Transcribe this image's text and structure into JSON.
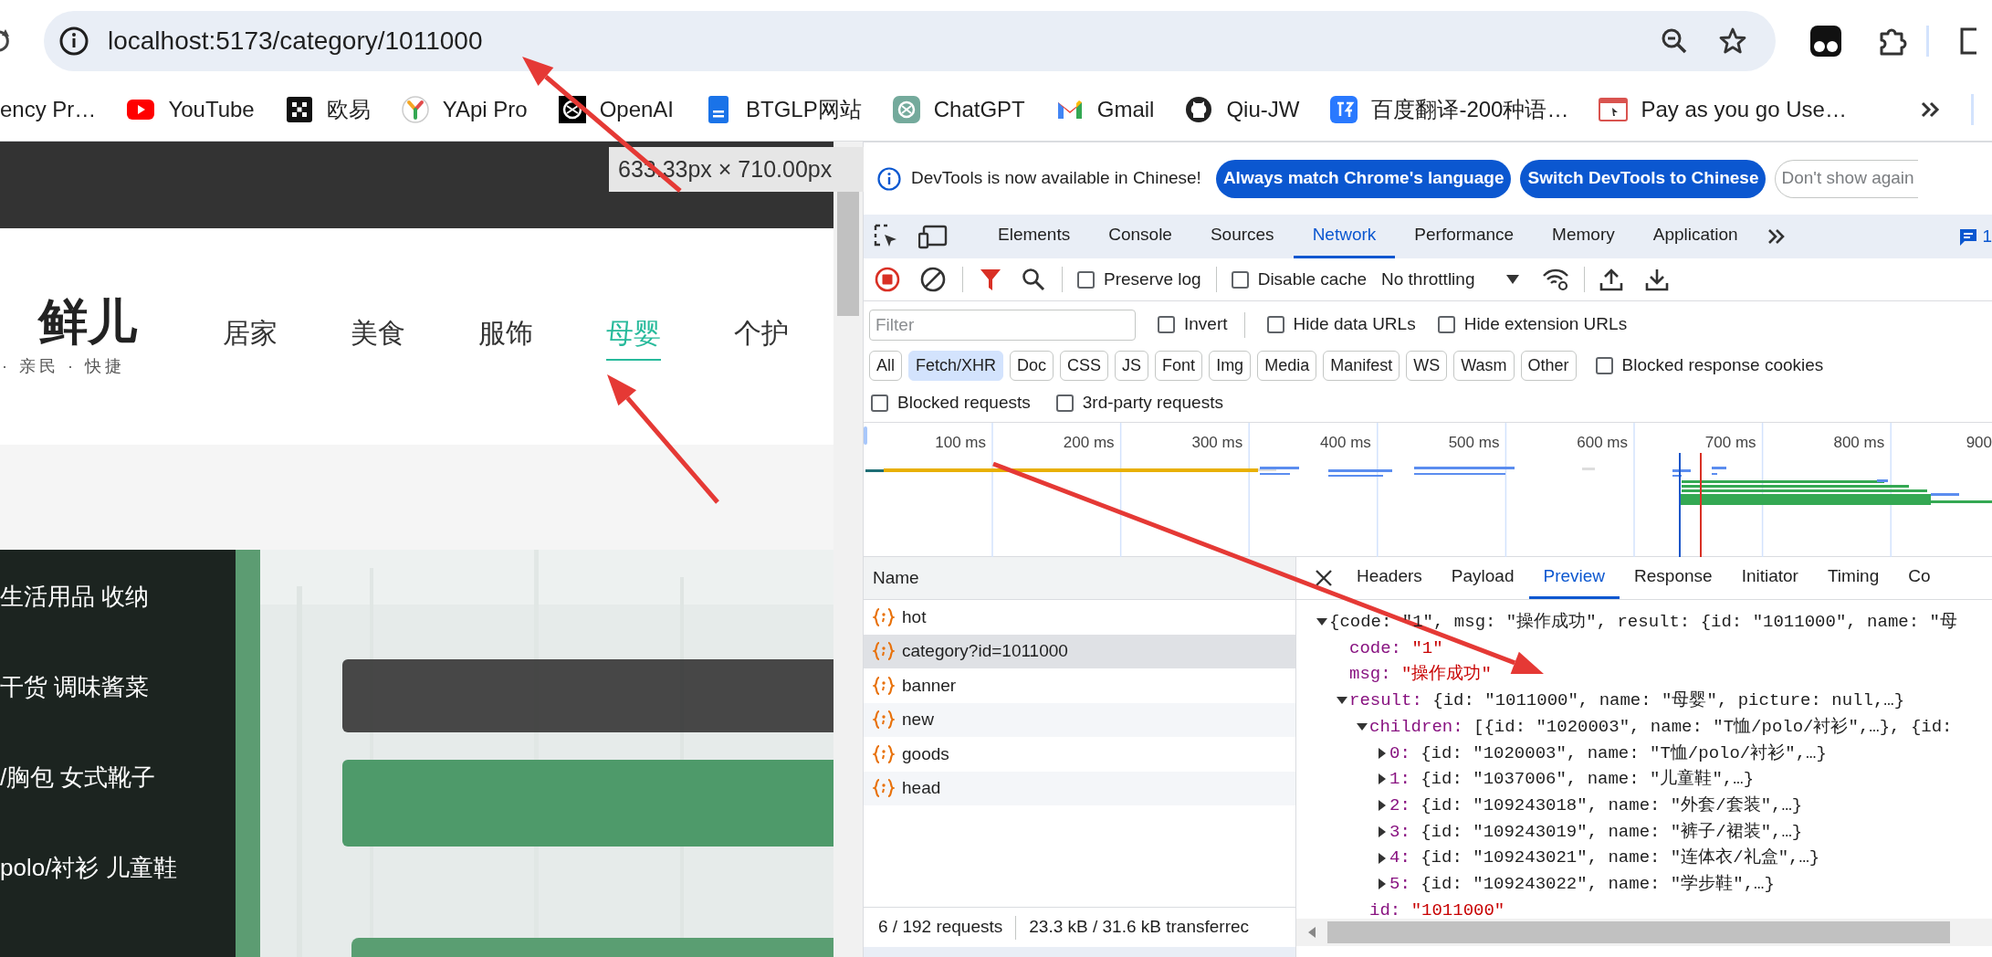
{
  "browser": {
    "url": "localhost:5173/category/1011000",
    "bookmarks": [
      {
        "label": "ency Pr…"
      },
      {
        "label": "YouTube"
      },
      {
        "label": "欧易"
      },
      {
        "label": "YApi Pro"
      },
      {
        "label": "OpenAI"
      },
      {
        "label": "BTGLP网站"
      },
      {
        "label": "ChatGPT"
      },
      {
        "label": "Gmail"
      },
      {
        "label": "Qiu-JW"
      },
      {
        "label": "百度翻译-200种语…"
      },
      {
        "label": "Pay as you go Use…"
      }
    ]
  },
  "page": {
    "size_tooltip": "633.33px × 710.00px",
    "logo": {
      "title": "鲜儿",
      "tagline": "· 亲民 · 快捷"
    },
    "nav": [
      {
        "label": "居家",
        "selected": false
      },
      {
        "label": "美食",
        "selected": false
      },
      {
        "label": "服饰",
        "selected": false
      },
      {
        "label": "母婴",
        "selected": true
      },
      {
        "label": "个护",
        "selected": false
      }
    ],
    "sidebar": [
      "生活用品 收纳",
      "干货 调味酱菜",
      "/胸包 女式靴子",
      "polo/衬衫 儿童鞋"
    ],
    "banner": {
      "kind": "picture"
    }
  },
  "devtools": {
    "infobar": {
      "message": "DevTools is now available in Chinese!",
      "buttons": [
        {
          "label": "Always match Chrome's language",
          "kind": "primary"
        },
        {
          "label": "Switch DevTools to Chinese",
          "kind": "primary"
        },
        {
          "label": "Don't show again",
          "kind": "secondary"
        }
      ]
    },
    "tabs": [
      {
        "label": "Elements",
        "selected": false
      },
      {
        "label": "Console",
        "selected": false
      },
      {
        "label": "Sources",
        "selected": false
      },
      {
        "label": "Network",
        "selected": true
      },
      {
        "label": "Performance",
        "selected": false
      },
      {
        "label": "Memory",
        "selected": false
      },
      {
        "label": "Application",
        "selected": false
      }
    ],
    "issues_count": "1",
    "toolbar_checkboxes": [
      {
        "label": "Preserve log",
        "checked": false
      },
      {
        "label": "Disable cache",
        "checked": false
      }
    ],
    "throttling": "No throttling",
    "filter": {
      "placeholder": "Filter"
    },
    "filter_checkboxes": [
      {
        "label": "Invert",
        "checked": false
      },
      {
        "label": "Hide data URLs",
        "checked": false
      },
      {
        "label": "Hide extension URLs",
        "checked": false
      }
    ],
    "type_filters": [
      {
        "label": "All",
        "selected": false
      },
      {
        "label": "Fetch/XHR",
        "selected": true
      },
      {
        "label": "Doc",
        "selected": false
      },
      {
        "label": "CSS",
        "selected": false
      },
      {
        "label": "JS",
        "selected": false
      },
      {
        "label": "Font",
        "selected": false
      },
      {
        "label": "Img",
        "selected": false
      },
      {
        "label": "Media",
        "selected": false
      },
      {
        "label": "Manifest",
        "selected": false
      },
      {
        "label": "WS",
        "selected": false
      },
      {
        "label": "Wasm",
        "selected": false
      },
      {
        "label": "Other",
        "selected": false
      }
    ],
    "type_checkboxes": [
      {
        "label": "Blocked response cookies",
        "checked": false
      }
    ],
    "extra_checkboxes": [
      {
        "label": "Blocked requests",
        "checked": false
      },
      {
        "label": "3rd-party requests",
        "checked": false
      }
    ],
    "timeline": {
      "ticks": [
        "100 ms",
        "200 ms",
        "300 ms",
        "400 ms",
        "500 ms",
        "600 ms",
        "700 ms",
        "800 ms",
        "900"
      ]
    },
    "requests": {
      "header": "Name",
      "rows": [
        {
          "name": "hot",
          "selected": false
        },
        {
          "name": "category?id=1011000",
          "selected": true
        },
        {
          "name": "banner",
          "selected": false
        },
        {
          "name": "new",
          "selected": false
        },
        {
          "name": "goods",
          "selected": false
        },
        {
          "name": "head",
          "selected": false
        }
      ],
      "summary": [
        "6 / 192 requests",
        "23.3 kB / 31.6 kB transferrec"
      ]
    },
    "detail": {
      "tabs": [
        {
          "label": "Headers",
          "selected": false
        },
        {
          "label": "Payload",
          "selected": false
        },
        {
          "label": "Preview",
          "selected": true
        },
        {
          "label": "Response",
          "selected": false
        },
        {
          "label": "Initiator",
          "selected": false
        },
        {
          "label": "Timing",
          "selected": false
        },
        {
          "label": "Co",
          "selected": false
        }
      ],
      "tree": [
        {
          "kind": "node",
          "expanded": true,
          "value": "{code: \"1\", msg: \"操作成功\", result: {id: \"1011000\", name: \"母",
          "children": [
            {
              "kind": "leaf",
              "key": "code:",
              "value": "\"1\""
            },
            {
              "kind": "leaf",
              "key": "msg:",
              "value": "\"操作成功\""
            },
            {
              "kind": "node",
              "expanded": true,
              "key": "result:",
              "value": "{id: \"1011000\", name: \"母婴\", picture: null,…}",
              "children": [
                {
                  "kind": "node",
                  "expanded": true,
                  "key": "children:",
                  "value": "[{id: \"1020003\", name: \"T恤/polo/衬衫\",…}, {id:",
                  "children": [
                    {
                      "kind": "node",
                      "expanded": false,
                      "key": "0:",
                      "value": "{id: \"1020003\", name: \"T恤/polo/衬衫\",…}"
                    },
                    {
                      "kind": "node",
                      "expanded": false,
                      "key": "1:",
                      "value": "{id: \"1037006\", name: \"儿童鞋\",…}"
                    },
                    {
                      "kind": "node",
                      "expanded": false,
                      "key": "2:",
                      "value": "{id: \"109243018\", name: \"外套/套装\",…}"
                    },
                    {
                      "kind": "node",
                      "expanded": false,
                      "key": "3:",
                      "value": "{id: \"109243019\", name: \"裤子/裙装\",…}"
                    },
                    {
                      "kind": "node",
                      "expanded": false,
                      "key": "4:",
                      "value": "{id: \"109243021\", name: \"连体衣/礼盒\",…}"
                    },
                    {
                      "kind": "node",
                      "expanded": false,
                      "key": "5:",
                      "value": "{id: \"109243022\", name: \"学步鞋\",…}"
                    }
                  ]
                },
                {
                  "kind": "leaf",
                  "key": "id:",
                  "value": "\"1011000\""
                }
              ]
            }
          ]
        }
      ]
    }
  }
}
